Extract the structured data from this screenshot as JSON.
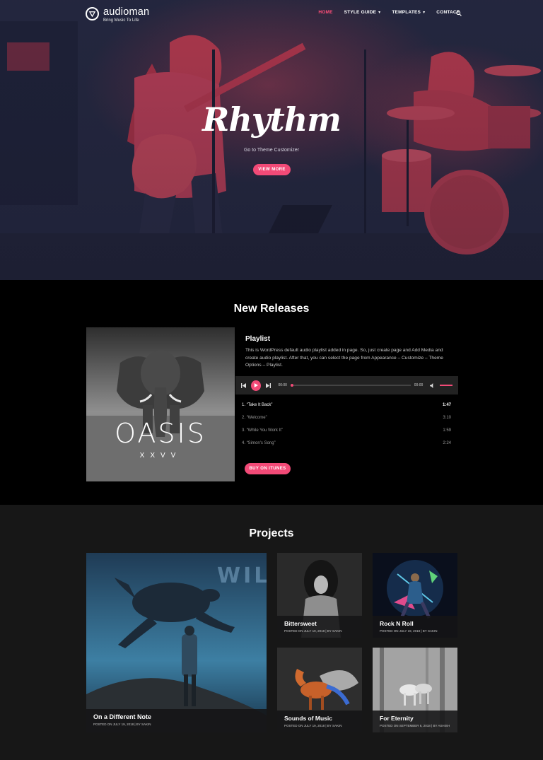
{
  "brand": {
    "name": "audioman",
    "tagline": "Bring Music To Life"
  },
  "nav": {
    "items": [
      {
        "label": "HOME",
        "active": true,
        "dropdown": false
      },
      {
        "label": "STYLE GUIDE",
        "active": false,
        "dropdown": true
      },
      {
        "label": "TEMPLATES",
        "active": false,
        "dropdown": true
      },
      {
        "label": "CONTACT",
        "active": false,
        "dropdown": false
      }
    ],
    "search_icon": "search-icon"
  },
  "hero": {
    "title": "Rhythm",
    "subtitle": "Go to Theme Customizer",
    "button": "VIEW MORE"
  },
  "releases": {
    "title": "New Releases",
    "album": {
      "title": "OASIS",
      "subtitle": "XXVV"
    },
    "playlist": {
      "title": "Playlist",
      "description": "This is WordPress default audio playlist added in page. So, just create page and Add Media and create audio playlist. After that, you can select the page from Appearance – Customize – Theme Options – Playlist.",
      "player": {
        "current_time": "00:00",
        "total_time": "00:00"
      },
      "tracks": [
        {
          "num": "1.",
          "title": "“Take It Back”",
          "duration": "1:47"
        },
        {
          "num": "2.",
          "title": "“Welcome”",
          "duration": "3:10"
        },
        {
          "num": "3.",
          "title": "“While You Work It”",
          "duration": "1:59"
        },
        {
          "num": "4.",
          "title": "“Simon’s Song”",
          "duration": "2:24"
        }
      ],
      "buy_button": "BUY ON ITUNES"
    }
  },
  "projects": {
    "title": "Projects",
    "cards": [
      {
        "title": "On a Different Note",
        "date": "POSTED ON JULY 19, 2018",
        "author": "BY SAKIN",
        "overlay_text": "WIL"
      },
      {
        "title": "Bittersweet",
        "date": "POSTED ON JULY 19, 2018",
        "author": "BY SAKIN"
      },
      {
        "title": "Rock N Roll",
        "date": "POSTED ON JULY 19, 2018",
        "author": "BY SAKIN"
      },
      {
        "title": "Sounds of Music",
        "date": "POSTED ON JULY 19, 2018",
        "author": "BY SAKIN"
      },
      {
        "title": "For Eternity",
        "date": "POSTED ON SEPTEMBER 6, 2018",
        "author": "BY ASHISH"
      }
    ]
  },
  "colors": {
    "accent": "#f24a77",
    "hero_red": "#c83a4e",
    "hero_dark": "#252a42"
  }
}
